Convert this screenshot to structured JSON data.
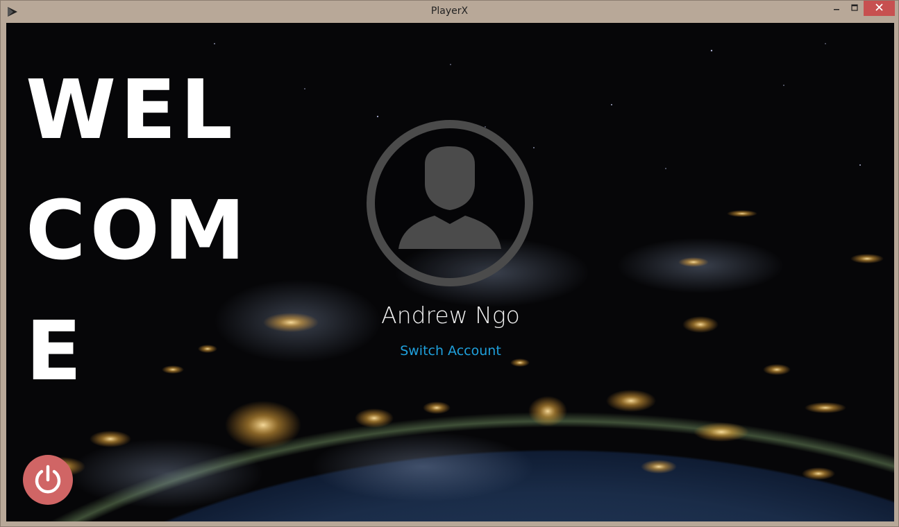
{
  "window": {
    "title": "PlayerX",
    "app_icon": "play-icon",
    "controls": {
      "minimize": "minimize-icon",
      "maximize": "maximize-icon",
      "close": "close-icon"
    },
    "close_color": "#c75050"
  },
  "main": {
    "welcome_text": "WEL\nCOM\nE",
    "user": {
      "name": "Andrew Ngo",
      "avatar_icon": "user-avatar-icon"
    },
    "switch_account_label": "Switch Account",
    "link_color": "#1fa0dc",
    "power_button": {
      "icon": "power-icon",
      "color": "#d06565"
    }
  }
}
